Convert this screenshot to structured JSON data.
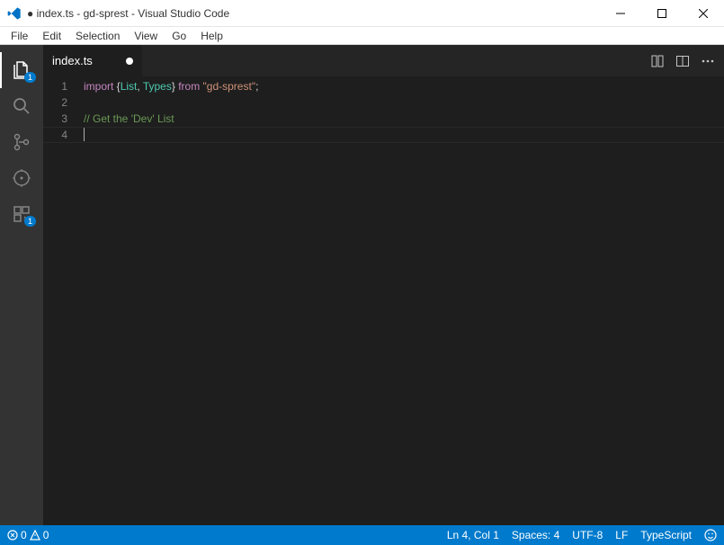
{
  "window": {
    "title": "● index.ts - gd-sprest - Visual Studio Code"
  },
  "menu": {
    "file": "File",
    "edit": "Edit",
    "selection": "Selection",
    "view": "View",
    "go": "Go",
    "help": "Help"
  },
  "activity": {
    "explorer_badge": "1",
    "scm_badge": "1"
  },
  "tabs": {
    "index": "index.ts"
  },
  "code": {
    "line_numbers": [
      "1",
      "2",
      "3",
      "4"
    ],
    "line1": {
      "import_kw": "import",
      "open_brace": " {",
      "list_type": "List",
      "comma": ", ",
      "types_type": "Types",
      "close_brace": "} ",
      "from_kw": "from",
      "space": " ",
      "module_str": "\"gd-sprest\"",
      "semi": ";"
    },
    "line3_comment": "// Get the 'Dev' List"
  },
  "status": {
    "errors": "0",
    "warnings": "0",
    "lncol": "Ln 4, Col 1",
    "spaces": "Spaces: 4",
    "encoding": "UTF-8",
    "eol": "LF",
    "language": "TypeScript"
  }
}
